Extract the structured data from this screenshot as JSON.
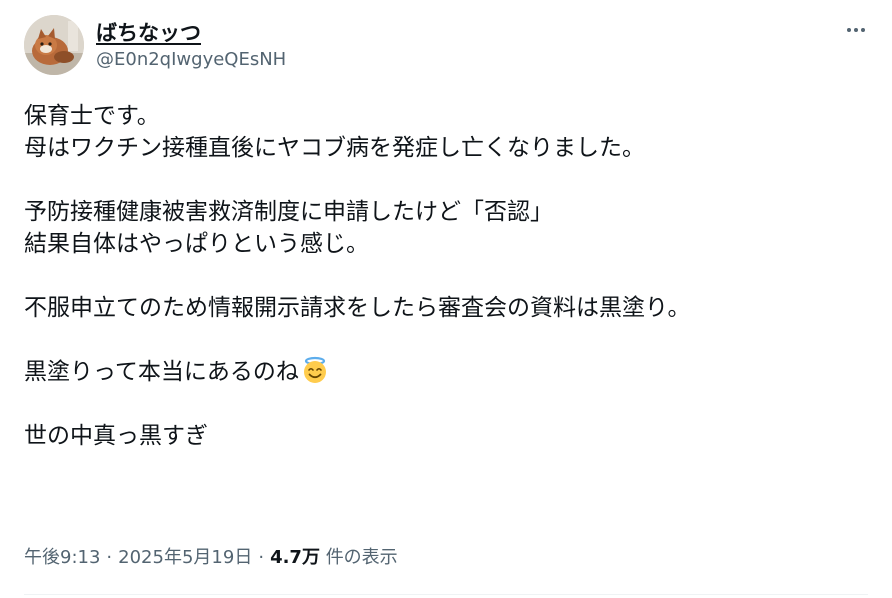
{
  "author": {
    "display_name": "ばちなッつ",
    "handle": "@E0n2qIwgyeQEsNH",
    "avatar_icon": "cat-avatar-icon"
  },
  "more_icon": "more-horizontal-icon",
  "tweet": {
    "lines": [
      "保育士です。",
      "母はワクチン接種直後にヤコブ病を発症し亡くなりました。",
      "",
      "予防接種健康被害救済制度に申請したけど「否認」",
      "結果自体はやっぱりという感じ。",
      "",
      "不服申立てのため情報開示請求をしたら審査会の資料は黒塗り。",
      "",
      "黒塗りって本当にあるのね",
      "",
      "世の中真っ黒すぎ"
    ],
    "emoji": "smiling-face-with-halo-icon"
  },
  "meta": {
    "time": "午後9:13",
    "separator": "·",
    "date": "2025年5月19日",
    "views_count": "4.7万",
    "views_label": "件の表示"
  },
  "colors": {
    "text_primary": "#0f1419",
    "text_secondary": "#536471",
    "divider": "#eff3f4",
    "emoji_face": "#ffcc4d",
    "emoji_halo": "#5dadec"
  }
}
